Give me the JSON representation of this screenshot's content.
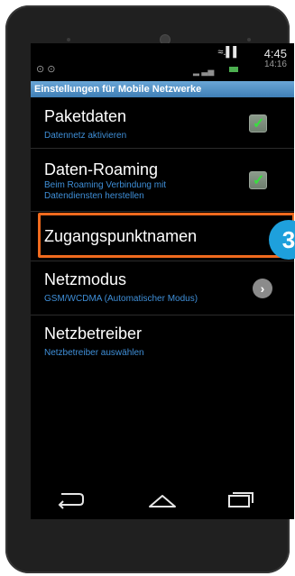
{
  "status_bar": {
    "time": "4:45",
    "time_under": "14:16",
    "signal": "≈.▌▌",
    "ghost_icons": "⊙ ⊙"
  },
  "title": "Einstellungen für Mobile Netzwerke",
  "settings": [
    {
      "title": "Paketdaten",
      "subtitle": "Datennetz aktivieren",
      "control": "checkbox",
      "checked": true
    },
    {
      "title": "Daten-Roaming",
      "subtitle": "Beim Roaming Verbindung mit Datendiensten herstellen",
      "control": "checkbox",
      "checked": true
    },
    {
      "title": "Zugangspunktnamen",
      "subtitle": "",
      "control": "none",
      "highlighted": true
    },
    {
      "title": "Netzmodus",
      "subtitle": "GSM/WCDMA (Automatischer Modus)",
      "control": "chevron"
    },
    {
      "title": "Netzbetreiber",
      "subtitle": "Netzbetreiber auswählen",
      "control": "none"
    }
  ],
  "step_badge": "3",
  "icons": {
    "checkmark": "✓",
    "chevron": "›",
    "back": "back-icon",
    "home": "home-icon",
    "recents": "recent-apps-icon"
  },
  "colors": {
    "accent_blue": "#3f8fd8",
    "highlight_orange": "#ef6a1e",
    "badge_blue": "#1ea0dc",
    "check_green": "#38e03e"
  }
}
